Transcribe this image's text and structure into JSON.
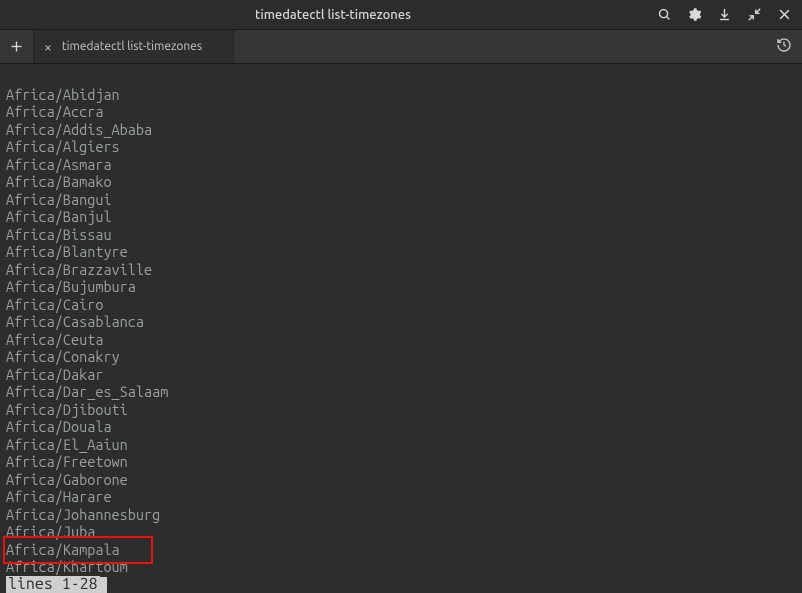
{
  "titlebar": {
    "title": "timedatectl list-timezones"
  },
  "tabs": {
    "active": {
      "label": "timedatectl list-timezones"
    }
  },
  "terminal": {
    "lines": [
      "Africa/Abidjan",
      "Africa/Accra",
      "Africa/Addis_Ababa",
      "Africa/Algiers",
      "Africa/Asmara",
      "Africa/Bamako",
      "Africa/Bangui",
      "Africa/Banjul",
      "Africa/Bissau",
      "Africa/Blantyre",
      "Africa/Brazzaville",
      "Africa/Bujumbura",
      "Africa/Cairo",
      "Africa/Casablanca",
      "Africa/Ceuta",
      "Africa/Conakry",
      "Africa/Dakar",
      "Africa/Dar_es_Salaam",
      "Africa/Djibouti",
      "Africa/Douala",
      "Africa/El_Aaiun",
      "Africa/Freetown",
      "Africa/Gaborone",
      "Africa/Harare",
      "Africa/Johannesburg",
      "Africa/Juba",
      "Africa/Kampala",
      "Africa/Khartoum"
    ],
    "status": "lines 1-28"
  }
}
